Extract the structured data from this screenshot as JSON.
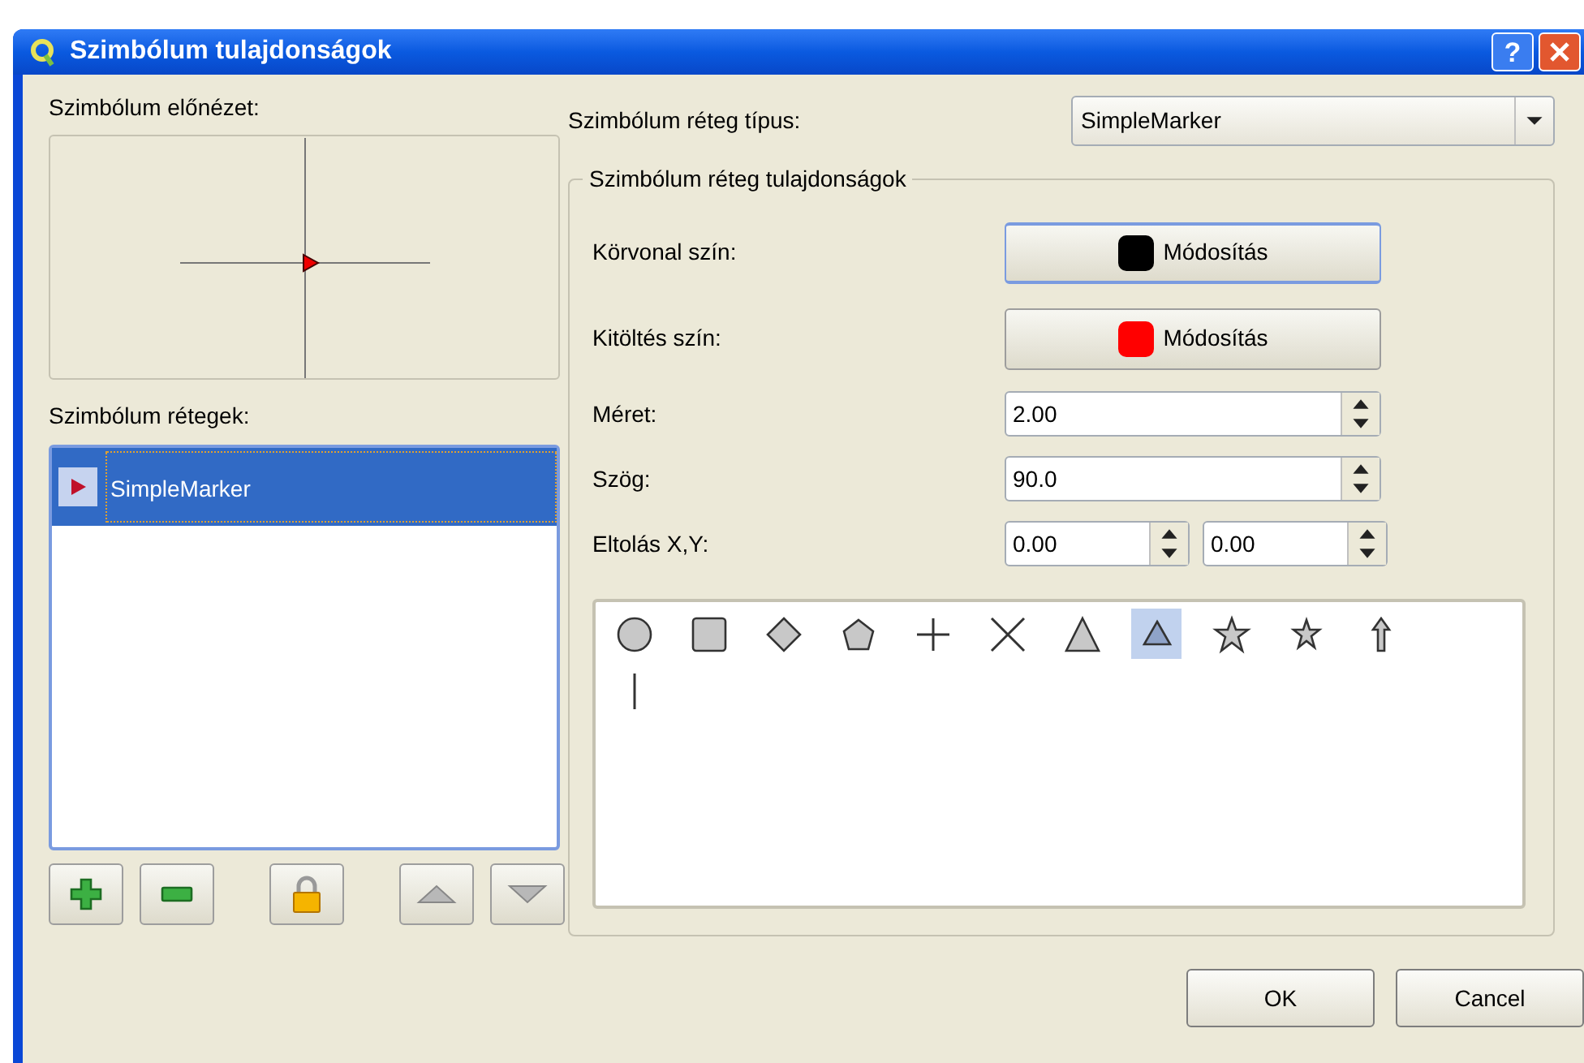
{
  "window": {
    "title": "Szimbólum tulajdonságok"
  },
  "title_buttons": [
    {
      "kind": "help",
      "label": "?"
    },
    {
      "kind": "close"
    }
  ],
  "preview": {
    "label": "Szimbólum előnézet:"
  },
  "layers": {
    "label": "Szimbólum rétegek:",
    "items": [
      {
        "name": "SimpleMarker",
        "selected": true
      }
    ]
  },
  "layer_buttons": [
    {
      "kind": "add"
    },
    {
      "kind": "remove"
    },
    {
      "kind": "lock"
    },
    {
      "kind": "up"
    },
    {
      "kind": "down"
    }
  ],
  "layer_type": {
    "label": "Szimbólum réteg típus:",
    "value": "SimpleMarker"
  },
  "properties": {
    "title": "Szimbólum réteg tulajdonságok",
    "rows": [
      {
        "kind": "color",
        "label": "Körvonal szín:",
        "button": "Módosítás",
        "color": "#000000",
        "focused": true
      },
      {
        "kind": "color",
        "label": "Kitöltés szín:",
        "button": "Módosítás",
        "color": "#ff0000",
        "focused": false
      },
      {
        "kind": "spin",
        "label": "Méret:",
        "values": [
          "2.00"
        ]
      },
      {
        "kind": "spin",
        "label": "Szög:",
        "values": [
          "90.0"
        ]
      },
      {
        "kind": "spin",
        "label": "Eltolás X,Y:",
        "values": [
          "0.00",
          "0.00"
        ]
      }
    ],
    "markers": [
      {
        "kind": "circle",
        "selected": false
      },
      {
        "kind": "rectangle",
        "selected": false
      },
      {
        "kind": "diamond",
        "selected": false
      },
      {
        "kind": "pentagon",
        "selected": false
      },
      {
        "kind": "cross",
        "selected": false
      },
      {
        "kind": "cross2",
        "selected": false
      },
      {
        "kind": "triangle",
        "selected": false
      },
      {
        "kind": "equilateral_triangle",
        "selected": true
      },
      {
        "kind": "star",
        "selected": false
      },
      {
        "kind": "regular_star",
        "selected": false
      },
      {
        "kind": "arrow",
        "selected": false
      },
      {
        "kind": "line",
        "selected": false
      }
    ]
  },
  "buttons": [
    "OK",
    "Cancel"
  ]
}
